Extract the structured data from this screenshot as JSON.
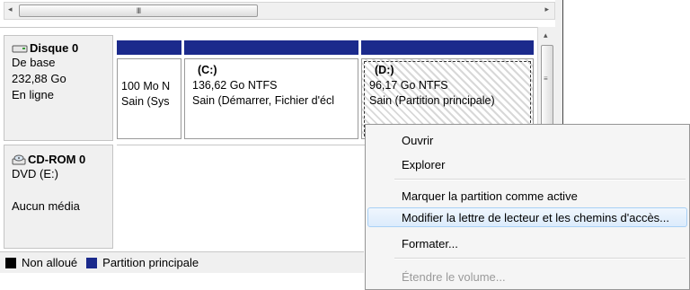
{
  "hscrollbar": {
    "left_arrow": "◂",
    "right_arrow": "▸",
    "grip": "III"
  },
  "vscrollbar": {
    "up_arrow": "▴",
    "down_arrow": "▾",
    "grip": "≡"
  },
  "disks": [
    {
      "icon": "hard-disk-icon",
      "name": "Disque 0",
      "type": "De base",
      "size": "232,88 Go",
      "status": "En ligne",
      "partitions": [
        {
          "label": "",
          "size": "100 Mo N",
          "status": "Sain (Sys"
        },
        {
          "label": "(C:)",
          "size": "136,62 Go NTFS",
          "status": "Sain (Démarrer, Fichier d'écl"
        },
        {
          "label": "(D:)",
          "size": "96,17 Go NTFS",
          "status": "Sain (Partition principale)"
        }
      ]
    },
    {
      "icon": "cd-rom-icon",
      "name": "CD-ROM 0",
      "type": "DVD (E:)",
      "status": "Aucun média"
    }
  ],
  "legend": [
    {
      "label": "Non alloué",
      "color": "#000000"
    },
    {
      "label": "Partition principale",
      "color": "#1b2a8c"
    }
  ],
  "context_menu": {
    "items": [
      {
        "label": "Ouvrir",
        "enabled": true
      },
      {
        "label": "Explorer",
        "enabled": true
      },
      {
        "label": "Marquer la partition comme active",
        "enabled": true
      },
      {
        "label": "Modifier la lettre de lecteur et les chemins d'accès...",
        "enabled": true,
        "highlighted": true
      },
      {
        "label": "Formater...",
        "enabled": true
      },
      {
        "label": "Étendre le volume...",
        "enabled": false
      }
    ]
  }
}
